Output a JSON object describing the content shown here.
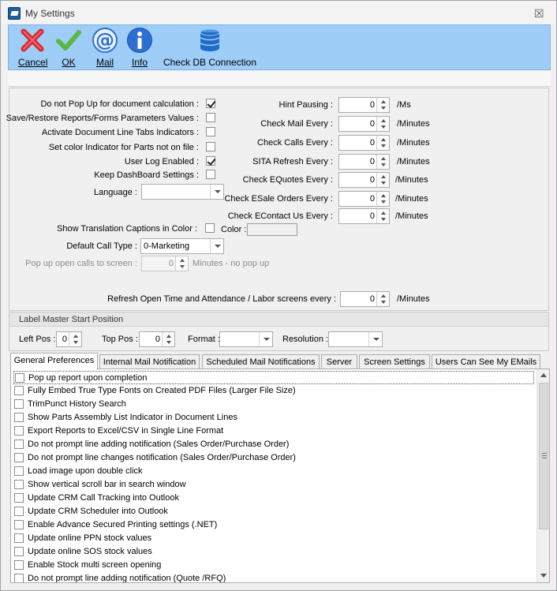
{
  "window": {
    "title": "My Settings",
    "close_glyph": "☒"
  },
  "toolbar": {
    "cancel": {
      "label": "Cancel",
      "icon": "cancel-x-icon"
    },
    "ok": {
      "label": "OK",
      "icon": "checkmark-icon"
    },
    "mail": {
      "label": "Mail",
      "icon": "at-sign-icon"
    },
    "info": {
      "label": "Info",
      "icon": "info-icon"
    },
    "check_db": {
      "label": "Check DB Connection",
      "icon": "database-icon"
    },
    "colors": {
      "background": "#9ecdf7",
      "cancel": "#d8262b",
      "ok": "#5cb646",
      "mail": "#2f6fd3",
      "info": "#2f6fd3",
      "db": "#1f6cc7"
    }
  },
  "left_options": {
    "no_popup_calc": {
      "label": "Do not Pop Up for document calculation :",
      "checked": true
    },
    "save_restore": {
      "label": "Save/Restore Reports/Forms Parameters Values :",
      "checked": false
    },
    "doc_line_tabs": {
      "label": "Activate Document Line Tabs Indicators :",
      "checked": false
    },
    "color_indicator": {
      "label": "Set color Indicator for Parts not on file :",
      "checked": false
    },
    "user_log": {
      "label": "User Log Enabled :",
      "checked": true
    },
    "keep_dashboard": {
      "label": "Keep DashBoard Settings :",
      "checked": false
    },
    "language": {
      "label": "Language :",
      "value": ""
    },
    "translation_colors": {
      "label": "Show Translation Captions in Color :",
      "checked": false,
      "color_label": "Color :"
    },
    "default_call_type": {
      "label": "Default Call Type :",
      "value": "0-Marketing"
    },
    "popup_calls": {
      "label": "Pop up open calls to screen :",
      "value": "0",
      "suffix": "Minutes - no pop up"
    }
  },
  "right_options": {
    "hint_pausing": {
      "label": "Hint Pausing :",
      "value": "0",
      "unit": "/Ms"
    },
    "check_mail": {
      "label": "Check Mail Every :",
      "value": "0",
      "unit": "/Minutes"
    },
    "check_calls": {
      "label": "Check Calls Every :",
      "value": "0",
      "unit": "/Minutes"
    },
    "sita_refresh": {
      "label": "SITA Refresh Every :",
      "value": "0",
      "unit": "/Minutes"
    },
    "check_equotes": {
      "label": "Check EQuotes Every :",
      "value": "0",
      "unit": "/Minutes"
    },
    "check_esale": {
      "label": "Check ESale Orders Every :",
      "value": "0",
      "unit": "/Minutes"
    },
    "check_econtact": {
      "label": "Check EContact Us Every :",
      "value": "0",
      "unit": "/Minutes"
    }
  },
  "refresh_open_time": {
    "label": "Refresh Open Time and Attendance / Labor screens every :",
    "value": "0",
    "unit": "/Minutes"
  },
  "label_master": {
    "title": "Label Master Start Position",
    "left_pos": {
      "label": "Left Pos :",
      "value": "0"
    },
    "top_pos": {
      "label": "Top Pos :",
      "value": "0"
    },
    "format": {
      "label": "Format :",
      "value": ""
    },
    "resolution": {
      "label": "Resolution :",
      "value": ""
    }
  },
  "tabs": [
    {
      "label": "General Preferences",
      "active": true
    },
    {
      "label": "Internal Mail Notification"
    },
    {
      "label": "Scheduled Mail Notifications"
    },
    {
      "label": "Server"
    },
    {
      "label": "Screen Settings"
    },
    {
      "label": "Users Can See My EMails"
    }
  ],
  "general_preferences": [
    {
      "label": "Pop up report upon completion",
      "checked": false
    },
    {
      "label": "Fully Embed True Type Fonts on Created PDF Files (Larger File Size)",
      "checked": false
    },
    {
      "label": "TrimPunct History Search",
      "checked": false
    },
    {
      "label": "Show Parts Assembly List Indicator in Document Lines",
      "checked": false
    },
    {
      "label": "Export Reports to Excel/CSV in Single Line Format",
      "checked": false
    },
    {
      "label": "Do not prompt line adding notification (Sales Order/Purchase Order)",
      "checked": false
    },
    {
      "label": "Do not prompt line changes notification (Sales Order/Purchase Order)",
      "checked": false
    },
    {
      "label": "Load image upon double click",
      "checked": false
    },
    {
      "label": "Show vertical scroll bar in search window",
      "checked": false
    },
    {
      "label": "Update CRM Call Tracking into Outlook",
      "checked": false
    },
    {
      "label": "Update CRM Scheduler into Outlook",
      "checked": false
    },
    {
      "label": "Enable Advance Secured Printing settings (.NET)",
      "checked": false
    },
    {
      "label": "Update online PPN stock values",
      "checked": false
    },
    {
      "label": "Update online SOS stock values",
      "checked": false
    },
    {
      "label": "Enable Stock multi screen opening",
      "checked": false
    },
    {
      "label": "Do not prompt line adding notification (Quote /RFQ)",
      "checked": false
    }
  ]
}
